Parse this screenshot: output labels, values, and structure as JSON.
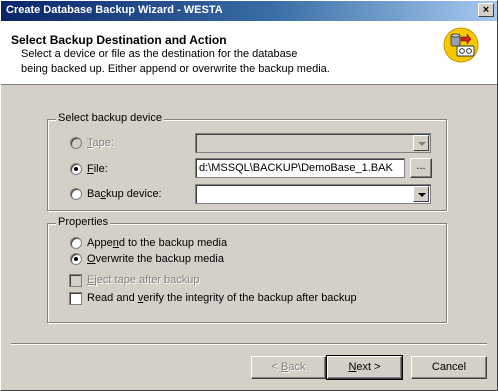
{
  "window": {
    "title": "Create Database Backup Wizard - WESTA",
    "close_glyph": "×"
  },
  "header": {
    "title": "Select Backup Destination and Action",
    "line1": "Select a device or file as the destination for the database",
    "line2": "being backed up. Either append or overwrite the backup media.",
    "icon": "database-backup-icon"
  },
  "device_group": {
    "label": "Select backup device",
    "options": [
      {
        "pre": "",
        "ul": "T",
        "post": "ape:",
        "selected": false,
        "enabled": false,
        "value": ""
      },
      {
        "pre": "",
        "ul": "F",
        "post": "ile:",
        "selected": true,
        "enabled": true,
        "value": "d:\\MSSQL\\BACKUP\\DemoBase_1.BAK"
      },
      {
        "pre": "Ba",
        "ul": "c",
        "post": "kup device:",
        "selected": false,
        "enabled": true,
        "value": ""
      }
    ],
    "browse_label": "..."
  },
  "properties_group": {
    "label": "Properties",
    "radios": [
      {
        "pre": "Appe",
        "ul": "n",
        "post": "d to the backup media",
        "selected": false
      },
      {
        "pre": "",
        "ul": "O",
        "post": "verwrite the backup media",
        "selected": true
      }
    ],
    "checks": [
      {
        "pre": "",
        "ul": "E",
        "post": "ject tape after backup",
        "checked": false,
        "enabled": false
      },
      {
        "pre": "Read and ",
        "ul": "v",
        "post": "erify the integrity of the backup after backup",
        "checked": false,
        "enabled": true
      }
    ]
  },
  "buttons": {
    "back": {
      "pre": "< ",
      "ul": "B",
      "post": "ack",
      "enabled": false
    },
    "next": {
      "pre": "",
      "ul": "N",
      "post": "ext >",
      "enabled": true
    },
    "cancel": {
      "label": "Cancel",
      "enabled": true
    }
  }
}
